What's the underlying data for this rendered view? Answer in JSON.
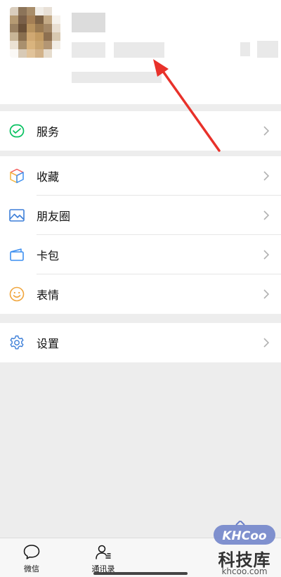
{
  "menu": {
    "services": "服务",
    "favorites": "收藏",
    "moments": "朋友圈",
    "cards": "卡包",
    "stickers": "表情",
    "settings": "设置"
  },
  "tabs": {
    "chats": "微信",
    "contacts": "通讯录"
  },
  "watermark": {
    "logo": "KHCOO",
    "brand": "科技库",
    "domain": "khcoo.com"
  },
  "colors": {
    "accent_green": "#07c160",
    "annotation_red": "#e8312a",
    "background": "#ededed"
  },
  "icons": {
    "services": "wechat-pay-icon",
    "favorites": "cube-icon",
    "moments": "picture-icon",
    "cards": "wallet-icon",
    "stickers": "smiley-icon",
    "settings": "gear-icon"
  }
}
